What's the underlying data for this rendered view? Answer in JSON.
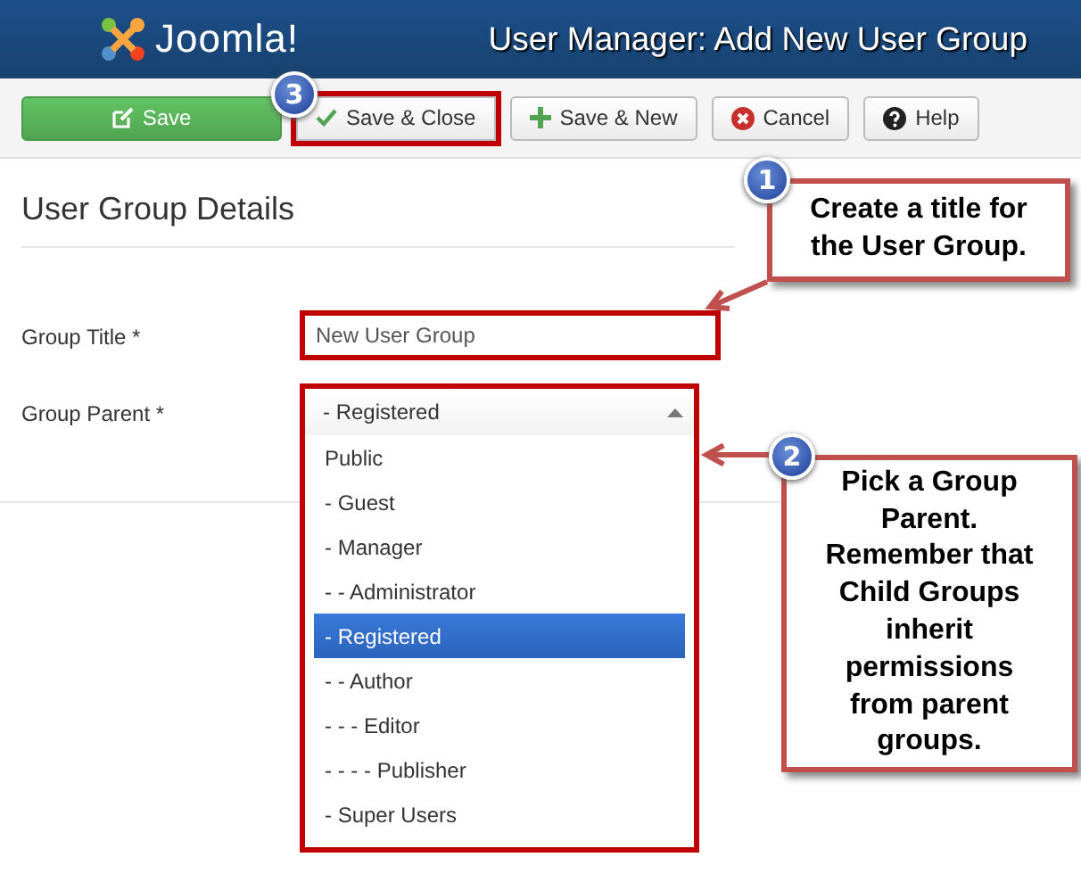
{
  "header": {
    "logo": "Joomla!",
    "title": "User Manager: Add New User Group"
  },
  "toolbar": [
    {
      "kind": "save",
      "label": "Save",
      "highlighted": false
    },
    {
      "kind": "check",
      "label": "Save & Close",
      "highlighted": true,
      "badge": "3"
    },
    {
      "kind": "plus",
      "label": "Save & New",
      "highlighted": false
    },
    {
      "kind": "cancel",
      "label": "Cancel",
      "highlighted": false
    },
    {
      "kind": "help",
      "label": "Help",
      "highlighted": false
    }
  ],
  "section_title": "User Group Details",
  "fields": [
    {
      "kind": "text",
      "label": "Group Title *",
      "value": "New User Group",
      "highlighted": true
    },
    {
      "kind": "select",
      "label": "Group Parent *",
      "value": "- Registered",
      "highlighted": true,
      "expanded": true,
      "options": [
        {
          "label": "Public",
          "selected": false
        },
        {
          "label": "- Guest",
          "selected": false
        },
        {
          "label": "- Manager",
          "selected": false
        },
        {
          "label": "- - Administrator",
          "selected": false
        },
        {
          "label": "- Registered",
          "selected": true
        },
        {
          "label": "- - Author",
          "selected": false
        },
        {
          "label": "- - - Editor",
          "selected": false
        },
        {
          "label": "- - - - Publisher",
          "selected": false
        },
        {
          "label": "- Super Users",
          "selected": false
        }
      ]
    }
  ],
  "callouts": [
    {
      "number": "1",
      "text": "Create a title for the User Group."
    },
    {
      "number": "2",
      "text": "Pick a Group Parent. Remember that Child Groups inherit permissions from parent groups."
    }
  ]
}
